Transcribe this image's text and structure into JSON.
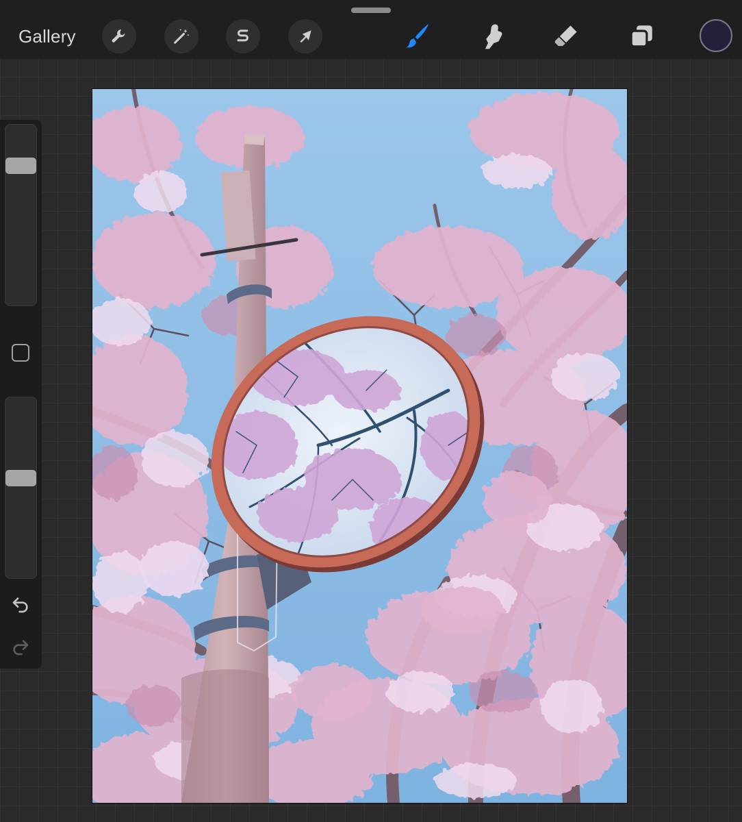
{
  "topbar": {
    "gallery_label": "Gallery",
    "tools": [
      {
        "name": "actions",
        "icon": "wrench-icon"
      },
      {
        "name": "adjustments",
        "icon": "magic-wand-icon"
      },
      {
        "name": "selection",
        "icon": "selection-s-icon"
      },
      {
        "name": "transform",
        "icon": "arrow-cursor-icon"
      },
      {
        "name": "brush",
        "icon": "brush-icon",
        "active": true
      },
      {
        "name": "smudge",
        "icon": "smudge-finger-icon"
      },
      {
        "name": "eraser",
        "icon": "eraser-icon"
      },
      {
        "name": "layers",
        "icon": "layers-icon"
      }
    ],
    "active_color": "#22203a",
    "active_tool_color": "#1e88ff"
  },
  "sidebar": {
    "brush_size_level": 0.8,
    "opacity_level": 0.56,
    "icons": [
      "modify-square-icon",
      "undo-icon",
      "redo-icon"
    ]
  },
  "canvas": {
    "artwork": "cherry-blossom-mirror-painting",
    "palette": {
      "sky": "#8fbfe6",
      "blossom": "#e2b3cf",
      "blossom_light": "#eedaf0",
      "branch": "#6e5a66",
      "pole": "#c9a8ae",
      "mirror_frame": "#c86a58",
      "mirror_glass": "#dfe8f4"
    }
  }
}
